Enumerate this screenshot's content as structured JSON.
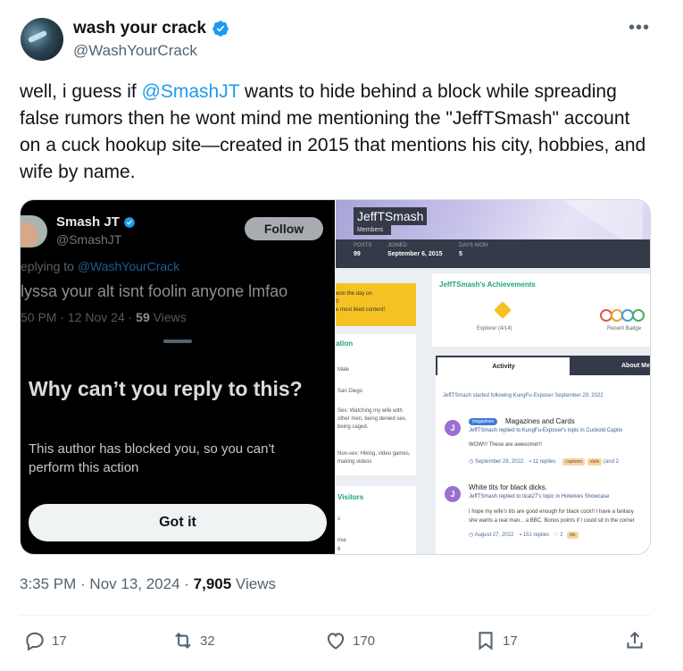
{
  "author": {
    "display_name": "wash your crack",
    "handle": "@WashYourCrack"
  },
  "tweet": {
    "text_part1": "well, i guess if ",
    "mention": "@SmashJT",
    "text_part2": " wants to hide behind a block while spreading false rumors then he wont mind me mentioning the \"JeffTSmash\" account on a cuck hookup site—created in 2015 that mentions his city, hobbies, and wife by name.",
    "timestamp": "3:35 PM · Nov 13, 2024 · ",
    "views_count": "7,905",
    "views_label": " Views"
  },
  "actions": {
    "replies": "17",
    "retweets": "32",
    "likes": "170",
    "bookmarks": "17"
  },
  "left_screenshot": {
    "name": "Smash JT",
    "handle": "@SmashJT",
    "follow_label": "Follow",
    "reply_prefix": "eplying to ",
    "reply_mention": "@WashYourCrack",
    "tweet_text": "lyssa your alt isnt foolin anyone lmfao",
    "meta": "50 PM · 12 Nov 24 · ",
    "views_count": "59",
    "views_label": " Views",
    "sheet_title": "Why can’t you reply to this?",
    "sheet_body": "This author has blocked you, so you can't perform this action",
    "button_label": "Got it"
  },
  "right_screenshot": {
    "username": "JeffTSmash",
    "members_label": "Members",
    "stats": [
      {
        "label": "POSTS",
        "value": "99"
      },
      {
        "label": "JOINED",
        "value": "September 6, 2015"
      },
      {
        "label": "DAYS WON",
        "value": "5"
      }
    ],
    "won_line1": "won the day on",
    "won_line2": "0",
    "won_line3": "e most liked content!",
    "info_heading": "ation",
    "info_rows": [
      "Male",
      "San Diego",
      "Sex: Watching my wife with other men, being denied sex, being caged.",
      "Non-sex: Hiking, video games, making videos"
    ],
    "visitors_heading": "Visitors",
    "visitors_rows": [
      "s",
      "nse",
      "6"
    ],
    "achievements_title": "JeffTSmash's Achievements",
    "achievement_label": "Explorer (4/14)",
    "recent_badges_label": "Recent Badge",
    "activity_tab": "Activity",
    "about_tab": "About Me",
    "activity_line1": "JeffTSmash started following KungFu-Exposer    September 29, 2022",
    "item1_tag": "magazines",
    "item1_title": "Magazines and Cards",
    "item1_sub": "JeffTSmash replied to KungFu-Exposer's topic in Cuckold Captio",
    "item1_text": "WOW!!! These are awesome!!!",
    "item1_date": "September 29, 2022",
    "item1_replies": "11 replies",
    "item1_tags": [
      "captions",
      "sluts"
    ],
    "item1_more": "(and 2",
    "item2_title": "White tits for black dicks.",
    "item2_sub": "JeffTSmash replied to tical27's topic in Hotwives Showcase",
    "item2_text1": "I hope my wife's tits are good enough for black cock!! I have a fantasy",
    "item2_text2": "she wants a real man... a BBC. Bonus points if I could sit in the corner",
    "item2_date": "August 27, 2022",
    "item2_replies": "151 replies",
    "item2_reactions": "2",
    "item2_tag": "tits"
  }
}
